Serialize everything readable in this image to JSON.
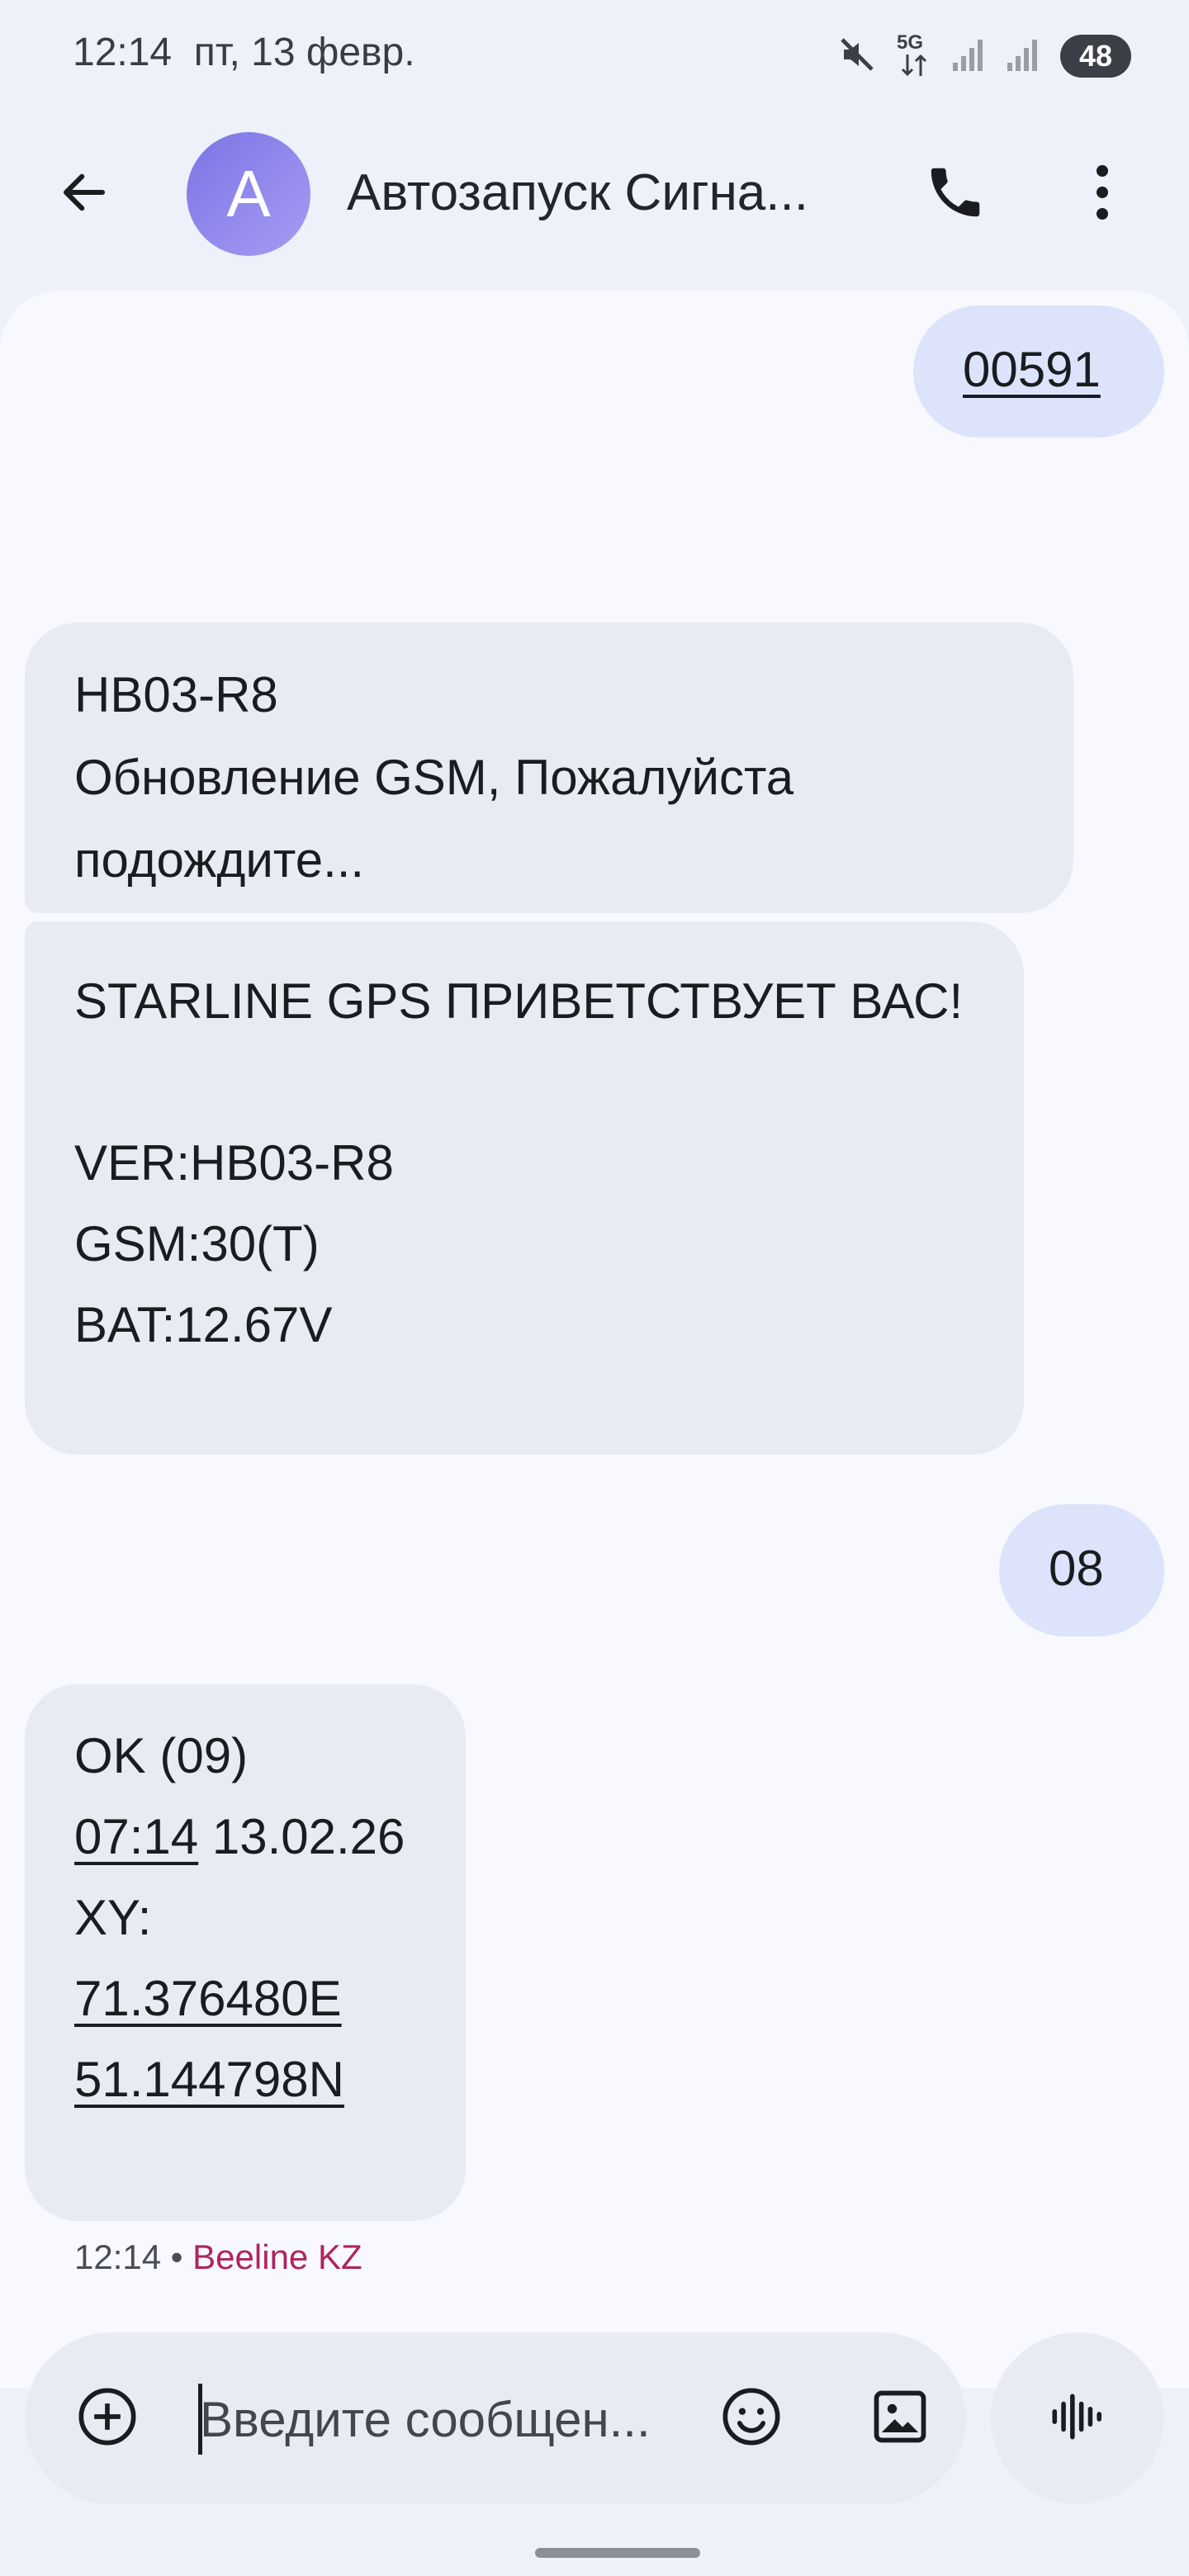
{
  "status_bar": {
    "time": "12:14",
    "date": "пт, 13 февр.",
    "network_label": "5G",
    "battery": "48",
    "icons": [
      "mute-icon",
      "5g-icon",
      "signal-icon",
      "signal-icon",
      "battery-icon"
    ]
  },
  "header": {
    "avatar_letter": "А",
    "contact_name": "Автозапуск Сигна...",
    "icons": [
      "back-arrow-icon",
      "phone-icon",
      "more-vert-icon"
    ]
  },
  "messages": [
    {
      "direction": "out",
      "lines": [
        "00591"
      ]
    },
    {
      "direction": "in",
      "lines": [
        "HB03-R8",
        "Обновление GSM, Пожалуйста",
        "подождите..."
      ]
    },
    {
      "direction": "in",
      "lines": [
        "STARLINE GPS ПРИВЕТСТВУЕТ ВАС!",
        "",
        "VER:HB03-R8",
        "GSM:30(T)",
        "BAT:12.67V"
      ]
    },
    {
      "direction": "out",
      "lines": [
        "08"
      ]
    },
    {
      "direction": "in",
      "lines": [
        "OK (09)",
        "07:14",
        "13.02.26",
        "XY:",
        "71.376480E",
        "51.144798N"
      ]
    }
  ],
  "message_meta": {
    "time": "12:14",
    "separator": "•",
    "carrier": "Beeline KZ"
  },
  "composer": {
    "placeholder": "Введите сообщен...",
    "icons": [
      "add-icon",
      "emoji-icon",
      "image-icon",
      "voice-icon"
    ]
  },
  "colors": {
    "background": "#eef1f9",
    "conversation_bg": "#f8f9fe",
    "outgoing_bubble": "#dce3fb",
    "incoming_bubble": "#e9ebf3",
    "avatar": "#8f88ec",
    "carrier_accent": "#b0245e"
  }
}
